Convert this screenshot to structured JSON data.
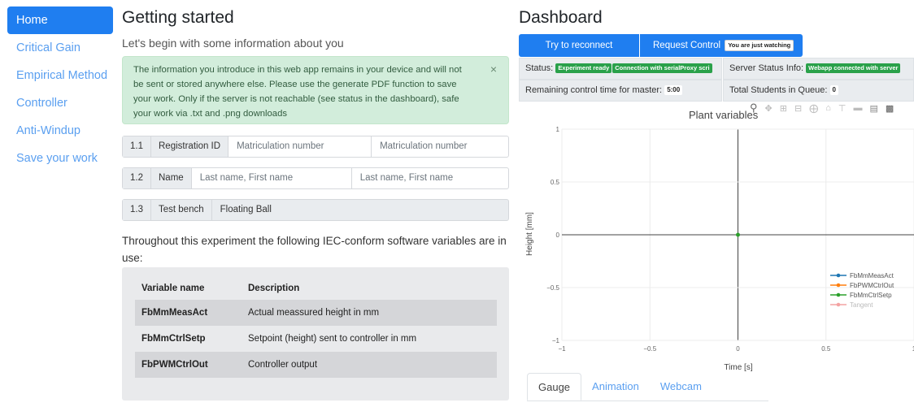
{
  "sidebar": {
    "items": [
      {
        "label": "Home",
        "active": true
      },
      {
        "label": "Critical Gain"
      },
      {
        "label": "Empirical Method"
      },
      {
        "label": "Controller"
      },
      {
        "label": "Anti-Windup"
      },
      {
        "label": "Save your work"
      }
    ]
  },
  "main": {
    "title": "Getting started",
    "subtitle": "Let's begin with some information about you",
    "alert": {
      "text": "The information you introduce in this web app remains in your device and will not be sent or stored anywhere else. Please use the generate PDF function to save your work. Only if the server is not reachable (see status in the dashboard), safe your work via .txt and .png downloads",
      "close": "×"
    },
    "fields": [
      {
        "num": "1.1",
        "label": "Registration ID",
        "placeholder1": "Matriculation number",
        "placeholder2": "Matriculation number"
      },
      {
        "num": "1.2",
        "label": "Name",
        "placeholder1": "Last name, First name",
        "placeholder2": "Last name, First name"
      },
      {
        "num": "1.3",
        "label": "Test bench",
        "value": "Floating Ball"
      }
    ],
    "intro": "Throughout this experiment the following IEC-conform software variables are in use:",
    "var_table": {
      "headers": [
        "Variable name",
        "Description"
      ],
      "rows": [
        [
          "FbMmMeasAct",
          "Actual meassured height in mm"
        ],
        [
          "FbMmCtrlSetp",
          "Setpoint (height) sent to controller in mm"
        ],
        [
          "FbPWMCtrlOut",
          "Controller output"
        ]
      ]
    }
  },
  "dashboard": {
    "title": "Dashboard",
    "reconnect_label": "Try to reconnect",
    "request_label": "Request Control",
    "watching_badge": "You are just watching",
    "status_label": "Status:",
    "status_badge1": "Experiment ready",
    "status_badge2": "Connection with serialProxy scri",
    "server_status_label": "Server Status Info:",
    "server_status_badge": "Webapp connected with server",
    "remaining_label": "Remaining control time for master:",
    "remaining_value": "5:00",
    "queue_label": "Total Students in Queue:",
    "queue_value": "0",
    "tabs": [
      {
        "label": "Gauge",
        "active": true
      },
      {
        "label": "Animation"
      },
      {
        "label": "Webcam"
      }
    ]
  },
  "chart_data": {
    "type": "line",
    "title": "Plant variables",
    "xlabel": "Time [s]",
    "ylabel": "Height [mm]",
    "xlim": [
      -1,
      1
    ],
    "ylim": [
      -1,
      1
    ],
    "xticks": [
      "−1",
      "−0.5",
      "0",
      "0.5",
      "1"
    ],
    "yticks": [
      "1",
      "0.5",
      "0",
      "−0.5",
      "−1"
    ],
    "grid": true,
    "legend_position": "bottom-right",
    "series": [
      {
        "name": "FbMmMeasAct",
        "color": "#1f77b4",
        "x": [],
        "y": []
      },
      {
        "name": "FbPWMCtrlOut",
        "color": "#ff7f0e",
        "x": [],
        "y": []
      },
      {
        "name": "FbMmCtrlSetp",
        "color": "#2ca02c",
        "x": [
          0
        ],
        "y": [
          0
        ]
      },
      {
        "name": "Tangent",
        "color": "#f4a3a3",
        "x": [],
        "y": []
      }
    ]
  }
}
